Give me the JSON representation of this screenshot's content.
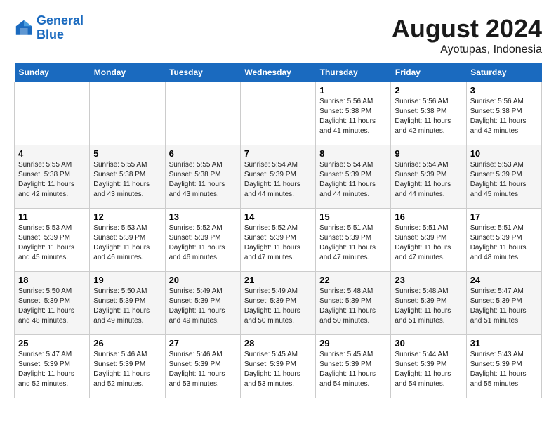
{
  "header": {
    "logo_line1": "General",
    "logo_line2": "Blue",
    "main_title": "August 2024",
    "subtitle": "Ayotupas, Indonesia"
  },
  "days_of_week": [
    "Sunday",
    "Monday",
    "Tuesday",
    "Wednesday",
    "Thursday",
    "Friday",
    "Saturday"
  ],
  "weeks": [
    [
      {
        "day": "",
        "info": ""
      },
      {
        "day": "",
        "info": ""
      },
      {
        "day": "",
        "info": ""
      },
      {
        "day": "",
        "info": ""
      },
      {
        "day": "1",
        "info": "Sunrise: 5:56 AM\nSunset: 5:38 PM\nDaylight: 11 hours\nand 41 minutes."
      },
      {
        "day": "2",
        "info": "Sunrise: 5:56 AM\nSunset: 5:38 PM\nDaylight: 11 hours\nand 42 minutes."
      },
      {
        "day": "3",
        "info": "Sunrise: 5:56 AM\nSunset: 5:38 PM\nDaylight: 11 hours\nand 42 minutes."
      }
    ],
    [
      {
        "day": "4",
        "info": "Sunrise: 5:55 AM\nSunset: 5:38 PM\nDaylight: 11 hours\nand 42 minutes."
      },
      {
        "day": "5",
        "info": "Sunrise: 5:55 AM\nSunset: 5:38 PM\nDaylight: 11 hours\nand 43 minutes."
      },
      {
        "day": "6",
        "info": "Sunrise: 5:55 AM\nSunset: 5:38 PM\nDaylight: 11 hours\nand 43 minutes."
      },
      {
        "day": "7",
        "info": "Sunrise: 5:54 AM\nSunset: 5:39 PM\nDaylight: 11 hours\nand 44 minutes."
      },
      {
        "day": "8",
        "info": "Sunrise: 5:54 AM\nSunset: 5:39 PM\nDaylight: 11 hours\nand 44 minutes."
      },
      {
        "day": "9",
        "info": "Sunrise: 5:54 AM\nSunset: 5:39 PM\nDaylight: 11 hours\nand 44 minutes."
      },
      {
        "day": "10",
        "info": "Sunrise: 5:53 AM\nSunset: 5:39 PM\nDaylight: 11 hours\nand 45 minutes."
      }
    ],
    [
      {
        "day": "11",
        "info": "Sunrise: 5:53 AM\nSunset: 5:39 PM\nDaylight: 11 hours\nand 45 minutes."
      },
      {
        "day": "12",
        "info": "Sunrise: 5:53 AM\nSunset: 5:39 PM\nDaylight: 11 hours\nand 46 minutes."
      },
      {
        "day": "13",
        "info": "Sunrise: 5:52 AM\nSunset: 5:39 PM\nDaylight: 11 hours\nand 46 minutes."
      },
      {
        "day": "14",
        "info": "Sunrise: 5:52 AM\nSunset: 5:39 PM\nDaylight: 11 hours\nand 47 minutes."
      },
      {
        "day": "15",
        "info": "Sunrise: 5:51 AM\nSunset: 5:39 PM\nDaylight: 11 hours\nand 47 minutes."
      },
      {
        "day": "16",
        "info": "Sunrise: 5:51 AM\nSunset: 5:39 PM\nDaylight: 11 hours\nand 47 minutes."
      },
      {
        "day": "17",
        "info": "Sunrise: 5:51 AM\nSunset: 5:39 PM\nDaylight: 11 hours\nand 48 minutes."
      }
    ],
    [
      {
        "day": "18",
        "info": "Sunrise: 5:50 AM\nSunset: 5:39 PM\nDaylight: 11 hours\nand 48 minutes."
      },
      {
        "day": "19",
        "info": "Sunrise: 5:50 AM\nSunset: 5:39 PM\nDaylight: 11 hours\nand 49 minutes."
      },
      {
        "day": "20",
        "info": "Sunrise: 5:49 AM\nSunset: 5:39 PM\nDaylight: 11 hours\nand 49 minutes."
      },
      {
        "day": "21",
        "info": "Sunrise: 5:49 AM\nSunset: 5:39 PM\nDaylight: 11 hours\nand 50 minutes."
      },
      {
        "day": "22",
        "info": "Sunrise: 5:48 AM\nSunset: 5:39 PM\nDaylight: 11 hours\nand 50 minutes."
      },
      {
        "day": "23",
        "info": "Sunrise: 5:48 AM\nSunset: 5:39 PM\nDaylight: 11 hours\nand 51 minutes."
      },
      {
        "day": "24",
        "info": "Sunrise: 5:47 AM\nSunset: 5:39 PM\nDaylight: 11 hours\nand 51 minutes."
      }
    ],
    [
      {
        "day": "25",
        "info": "Sunrise: 5:47 AM\nSunset: 5:39 PM\nDaylight: 11 hours\nand 52 minutes."
      },
      {
        "day": "26",
        "info": "Sunrise: 5:46 AM\nSunset: 5:39 PM\nDaylight: 11 hours\nand 52 minutes."
      },
      {
        "day": "27",
        "info": "Sunrise: 5:46 AM\nSunset: 5:39 PM\nDaylight: 11 hours\nand 53 minutes."
      },
      {
        "day": "28",
        "info": "Sunrise: 5:45 AM\nSunset: 5:39 PM\nDaylight: 11 hours\nand 53 minutes."
      },
      {
        "day": "29",
        "info": "Sunrise: 5:45 AM\nSunset: 5:39 PM\nDaylight: 11 hours\nand 54 minutes."
      },
      {
        "day": "30",
        "info": "Sunrise: 5:44 AM\nSunset: 5:39 PM\nDaylight: 11 hours\nand 54 minutes."
      },
      {
        "day": "31",
        "info": "Sunrise: 5:43 AM\nSunset: 5:39 PM\nDaylight: 11 hours\nand 55 minutes."
      }
    ]
  ]
}
